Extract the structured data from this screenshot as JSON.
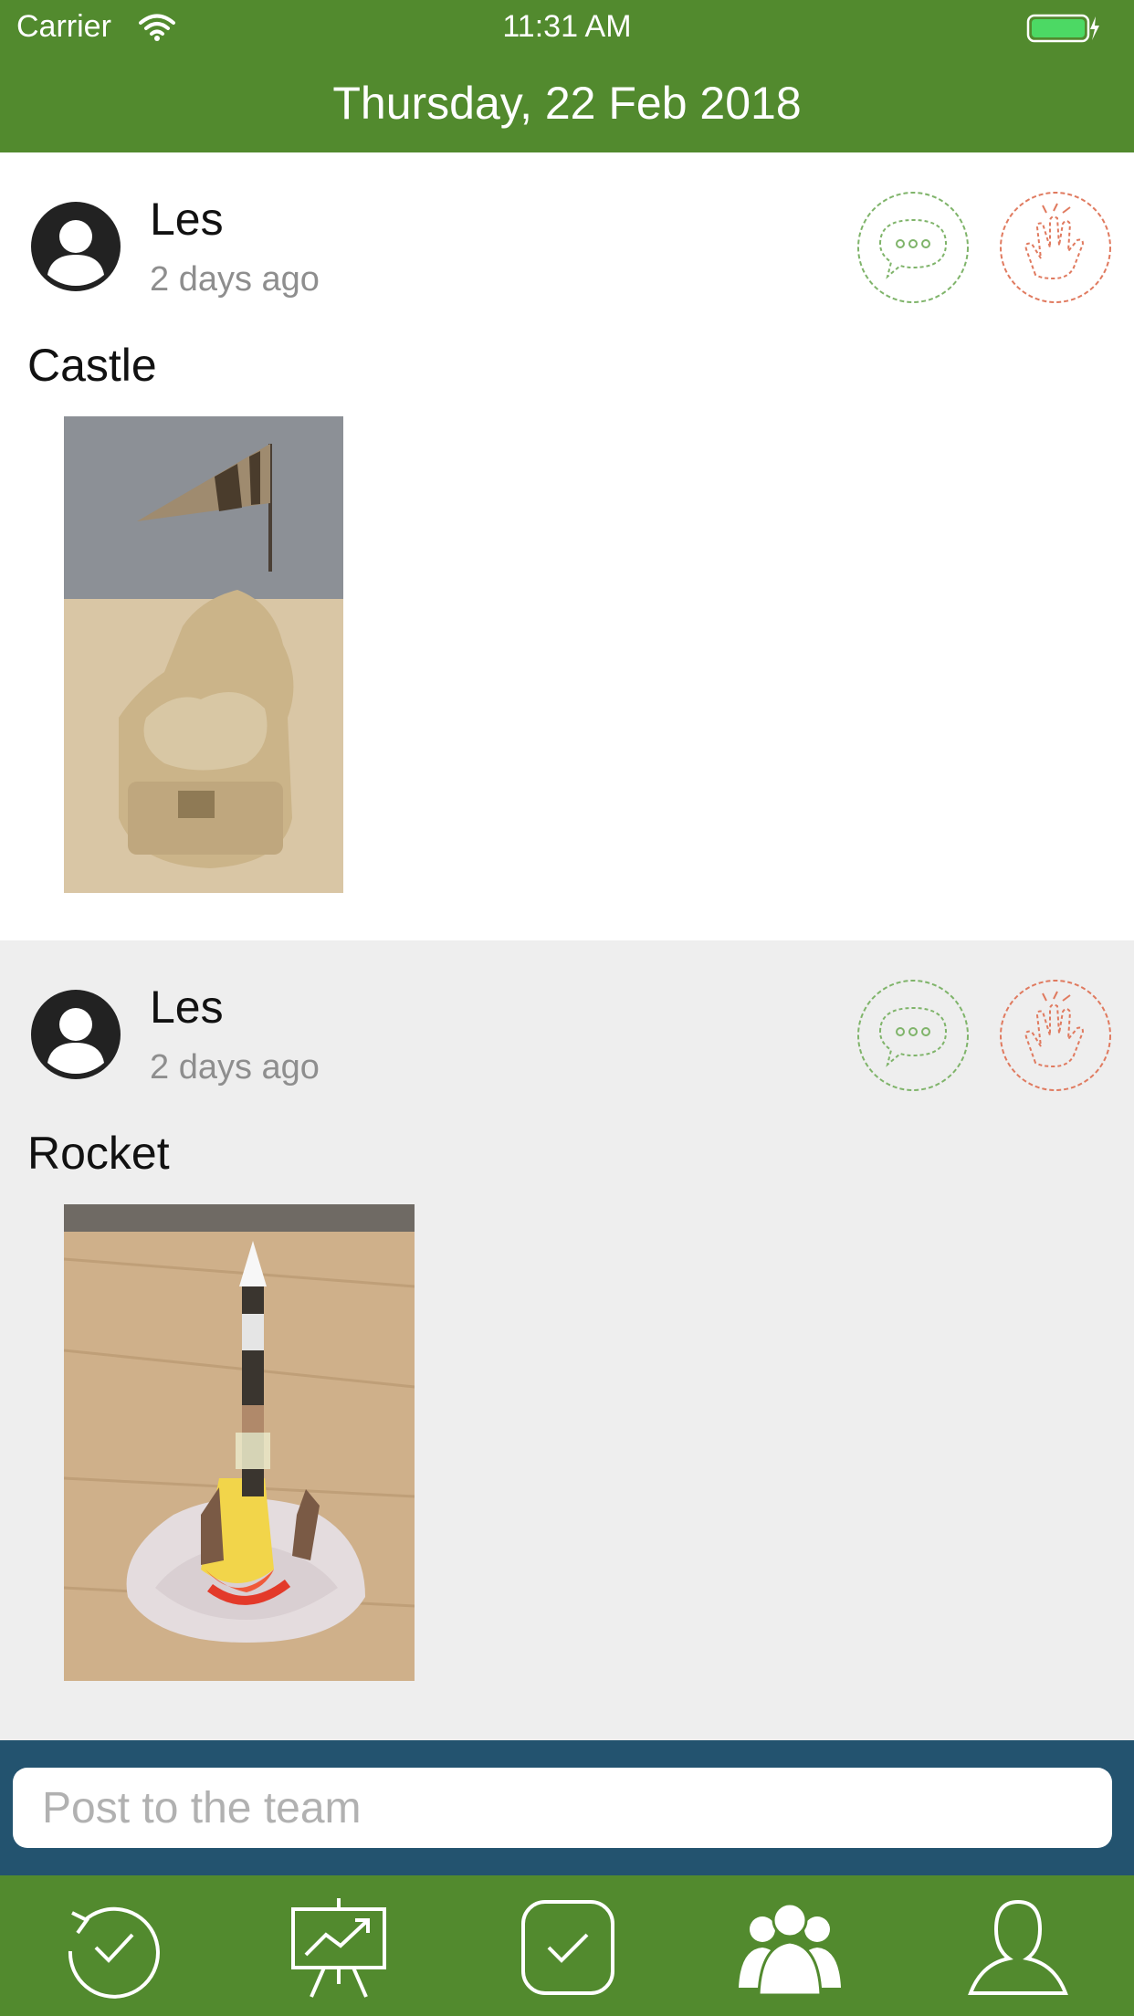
{
  "status_bar": {
    "carrier": "Carrier",
    "time": "11:31 AM",
    "wifi_icon": "wifi-icon",
    "battery_icon": "battery-charging-icon"
  },
  "header": {
    "title": "Thursday, 22 Feb 2018"
  },
  "posts": [
    {
      "author": "Les",
      "time": "2 days ago",
      "caption": "Castle",
      "image": "castle-photo",
      "actions": [
        "comment-icon",
        "clap-icon"
      ]
    },
    {
      "author": "Les",
      "time": "2 days ago",
      "caption": "Rocket",
      "image": "rocket-photo",
      "actions": [
        "comment-icon",
        "clap-icon"
      ]
    }
  ],
  "composer": {
    "placeholder": "Post to the team",
    "value": ""
  },
  "tabbar": {
    "tabs": [
      "history-icon",
      "presentation-chart-icon",
      "checkbox-icon",
      "team-icon",
      "profile-icon"
    ],
    "active_tab": "team-icon"
  },
  "colors": {
    "brand_green": "#528a2e",
    "composer_blue": "#23536f",
    "comment_green": "#7fb46a",
    "clap_red": "#e07a5f",
    "feed_alt_bg": "#eeeeee"
  }
}
